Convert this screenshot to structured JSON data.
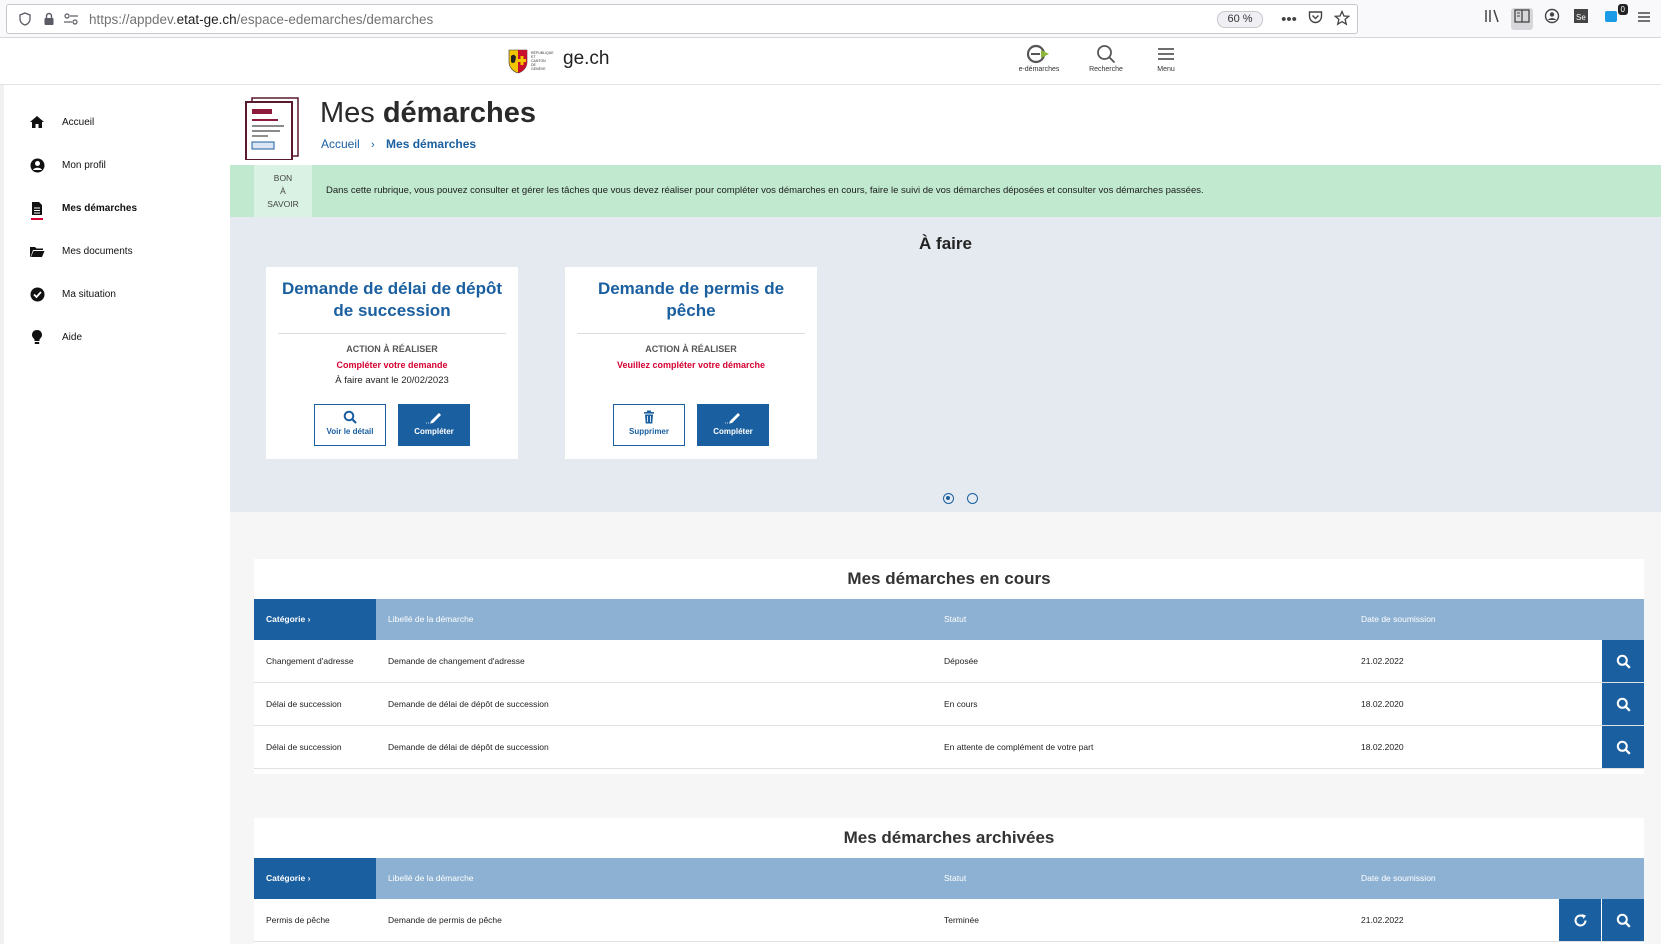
{
  "browser": {
    "url_prefix": "https://appdev.",
    "url_domain": "etat-ge.ch",
    "url_path": "/espace-edemarches/demarches",
    "zoom": "60 %",
    "notification_badge": "0"
  },
  "header": {
    "brand": "ge.ch",
    "crest_text": "RÉPUBLIQUE ET CANTON DE GENÈVE",
    "items": [
      {
        "label": "e-démarches"
      },
      {
        "label": "Recherche"
      },
      {
        "label": "Menu"
      }
    ]
  },
  "sidebar": {
    "items": [
      {
        "label": "Accueil",
        "icon": "home-icon"
      },
      {
        "label": "Mon profil",
        "icon": "user-icon"
      },
      {
        "label": "Mes démarches",
        "icon": "document-icon",
        "active": true
      },
      {
        "label": "Mes documents",
        "icon": "folder-icon"
      },
      {
        "label": "Ma situation",
        "icon": "check-circle-icon"
      },
      {
        "label": "Aide",
        "icon": "lightbulb-icon"
      }
    ]
  },
  "page": {
    "title_light": "Mes ",
    "title_bold": "démarches",
    "breadcrumb": {
      "home": "Accueil",
      "current": "Mes démarches"
    }
  },
  "info": {
    "label_lines": [
      "BON",
      "À",
      "SAVOIR"
    ],
    "text": "Dans cette rubrique, vous pouvez consulter et gérer les tâches que vous devez réaliser pour compléter vos démarches en cours, faire le suivi de vos démarches déposées et consulter vos démarches passées."
  },
  "todo": {
    "title": "À faire",
    "cards": [
      {
        "title": "Demande de délai de dépôt de succession",
        "action_label": "ACTION À RÉALISER",
        "cta": "Compléter votre demande",
        "due": "À faire avant le 20/02/2023",
        "buttons": [
          {
            "label": "Voir le détail",
            "style": "outline"
          },
          {
            "label": "Compléter",
            "style": "solid"
          }
        ]
      },
      {
        "title": "Demande de permis de pêche",
        "action_label": "ACTION À RÉALISER",
        "cta": "Veuillez compléter votre démarche",
        "due": "",
        "buttons": [
          {
            "label": "Supprimer",
            "style": "outline"
          },
          {
            "label": "Compléter",
            "style": "solid"
          }
        ]
      }
    ],
    "pagination": {
      "pages": 2,
      "current": 1
    }
  },
  "en_cours": {
    "title": "Mes démarches en cours",
    "headers": [
      "Catégorie",
      "Libellé de la démarche",
      "Statut",
      "Date de soumission"
    ],
    "rows": [
      {
        "categorie": "Changement d'adresse",
        "libelle": "Demande de changement d'adresse",
        "statut": "Déposée",
        "date": "21.02.2022"
      },
      {
        "categorie": "Délai de succession",
        "libelle": "Demande de délai de dépôt de succession",
        "statut": "En cours",
        "date": "18.02.2020"
      },
      {
        "categorie": "Délai de succession",
        "libelle": "Demande de délai de dépôt de succession",
        "statut": "En attente de complément de votre part",
        "date": "18.02.2020"
      }
    ]
  },
  "archivees": {
    "title": "Mes démarches archivées",
    "headers": [
      "Catégorie",
      "Libellé de la démarche",
      "Statut",
      "Date de soumission"
    ],
    "rows": [
      {
        "categorie": "Permis de pêche",
        "libelle": "Demande de permis de pêche",
        "statut": "Terminée",
        "date": "21.02.2022"
      }
    ]
  },
  "colors": {
    "primary_blue": "#1a5fa0",
    "table_header": "#8db1d2",
    "alert_red": "#d50032",
    "info_green": "#c0e9cf",
    "todo_bg": "#e5eaf1"
  }
}
